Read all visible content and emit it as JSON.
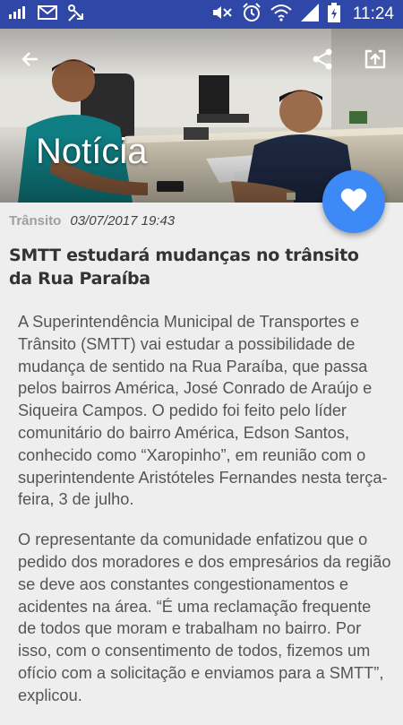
{
  "status_bar": {
    "time": "11:24",
    "left_icons": [
      "signal-bars-icon",
      "mail-icon",
      "usb-icon"
    ],
    "right_icons": [
      "mute-icon",
      "alarm-icon",
      "wifi-icon",
      "cell-signal-icon",
      "battery-charging-icon"
    ],
    "color": "#2f47a6"
  },
  "header": {
    "title": "Notícia",
    "icons": [
      "back-arrow-icon",
      "share-icon",
      "open-external-icon"
    ]
  },
  "fab": {
    "icon": "heart-icon",
    "color": "#3d8af7"
  },
  "article": {
    "category": "Trânsito",
    "date": "03/07/2017 19:43",
    "headline": "SMTT estudará mudanças no trânsito da Rua Paraíba",
    "paragraphs": [
      "A Superintendência Municipal de Transportes e Trânsito (SMTT) vai estudar a possibilidade de mudança de sentido na Rua Paraíba, que passa pelos bairros América, José Conrado de Araújo e Siqueira Campos. O pedido foi feito pelo líder comunitário do bairro América, Edson Santos, conhecido como “Xaropinho”, em reunião com o superintendente Aristóteles Fernandes nesta terça-feira, 3 de julho.",
      "O representante da comunidade enfatizou que o pedido dos moradores e dos empresários da região se deve aos constantes congestionamentos e acidentes na área. “É uma reclamação frequente de todos que moram e trabalham no bairro. Por isso, com o consentimento de todos, fizemos um ofício com a solicitação e enviamos para a SMTT”, explicou."
    ]
  }
}
